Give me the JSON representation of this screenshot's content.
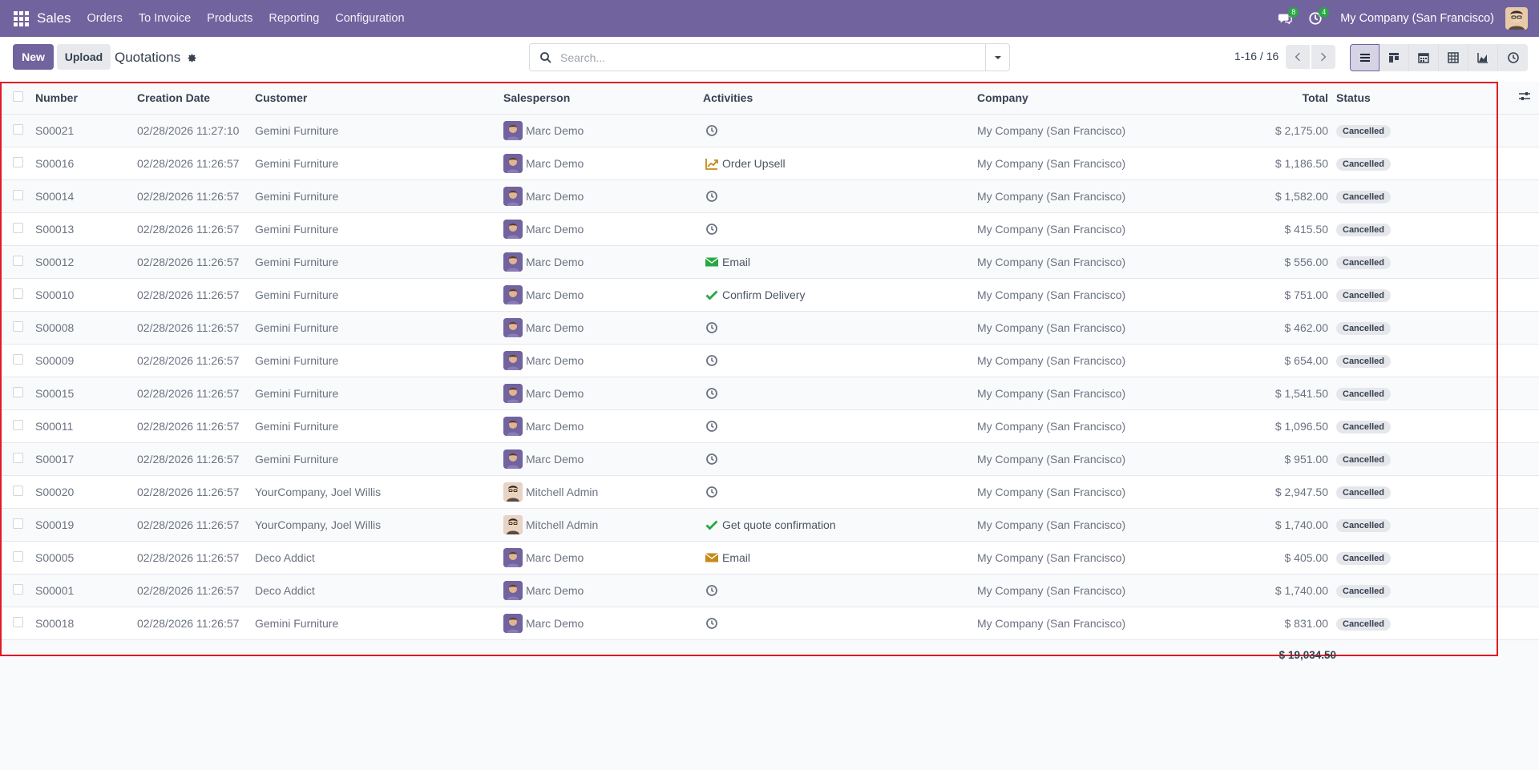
{
  "navbar": {
    "app_name": "Sales",
    "menu": [
      "Orders",
      "To Invoice",
      "Products",
      "Reporting",
      "Configuration"
    ],
    "messages_count": "8",
    "activities_count": "4",
    "company": "My Company (San Francisco)"
  },
  "control": {
    "new_label": "New",
    "upload_label": "Upload",
    "breadcrumb": "Quotations",
    "search_placeholder": "Search...",
    "pager": "1-16 / 16"
  },
  "table": {
    "headers": {
      "number": "Number",
      "creation_date": "Creation Date",
      "customer": "Customer",
      "salesperson": "Salesperson",
      "activities": "Activities",
      "company": "Company",
      "total": "Total",
      "status": "Status"
    },
    "rows": [
      {
        "number": "S00021",
        "date": "02/28/2026 11:27:10",
        "customer": "Gemini Furniture",
        "salesperson": "Marc Demo",
        "sp_type": "marc",
        "activity_icon": "clock-icon",
        "activity": "",
        "company": "My Company (San Francisco)",
        "total": "$ 2,175.00",
        "status": "Cancelled"
      },
      {
        "number": "S00016",
        "date": "02/28/2026 11:26:57",
        "customer": "Gemini Furniture",
        "salesperson": "Marc Demo",
        "sp_type": "marc",
        "activity_icon": "chart-up-icon",
        "activity": "Order Upsell",
        "company": "My Company (San Francisco)",
        "total": "$ 1,186.50",
        "status": "Cancelled"
      },
      {
        "number": "S00014",
        "date": "02/28/2026 11:26:57",
        "customer": "Gemini Furniture",
        "salesperson": "Marc Demo",
        "sp_type": "marc",
        "activity_icon": "clock-icon",
        "activity": "",
        "company": "My Company (San Francisco)",
        "total": "$ 1,582.00",
        "status": "Cancelled"
      },
      {
        "number": "S00013",
        "date": "02/28/2026 11:26:57",
        "customer": "Gemini Furniture",
        "salesperson": "Marc Demo",
        "sp_type": "marc",
        "activity_icon": "clock-icon",
        "activity": "",
        "company": "My Company (San Francisco)",
        "total": "$ 415.50",
        "status": "Cancelled"
      },
      {
        "number": "S00012",
        "date": "02/28/2026 11:26:57",
        "customer": "Gemini Furniture",
        "salesperson": "Marc Demo",
        "sp_type": "marc",
        "activity_icon": "email-green-icon",
        "activity": "Email",
        "company": "My Company (San Francisco)",
        "total": "$ 556.00",
        "status": "Cancelled"
      },
      {
        "number": "S00010",
        "date": "02/28/2026 11:26:57",
        "customer": "Gemini Furniture",
        "salesperson": "Marc Demo",
        "sp_type": "marc",
        "activity_icon": "check-icon",
        "activity": "Confirm Delivery",
        "company": "My Company (San Francisco)",
        "total": "$ 751.00",
        "status": "Cancelled"
      },
      {
        "number": "S00008",
        "date": "02/28/2026 11:26:57",
        "customer": "Gemini Furniture",
        "salesperson": "Marc Demo",
        "sp_type": "marc",
        "activity_icon": "clock-icon",
        "activity": "",
        "company": "My Company (San Francisco)",
        "total": "$ 462.00",
        "status": "Cancelled"
      },
      {
        "number": "S00009",
        "date": "02/28/2026 11:26:57",
        "customer": "Gemini Furniture",
        "salesperson": "Marc Demo",
        "sp_type": "marc",
        "activity_icon": "clock-icon",
        "activity": "",
        "company": "My Company (San Francisco)",
        "total": "$ 654.00",
        "status": "Cancelled"
      },
      {
        "number": "S00015",
        "date": "02/28/2026 11:26:57",
        "customer": "Gemini Furniture",
        "salesperson": "Marc Demo",
        "sp_type": "marc",
        "activity_icon": "clock-icon",
        "activity": "",
        "company": "My Company (San Francisco)",
        "total": "$ 1,541.50",
        "status": "Cancelled"
      },
      {
        "number": "S00011",
        "date": "02/28/2026 11:26:57",
        "customer": "Gemini Furniture",
        "salesperson": "Marc Demo",
        "sp_type": "marc",
        "activity_icon": "clock-icon",
        "activity": "",
        "company": "My Company (San Francisco)",
        "total": "$ 1,096.50",
        "status": "Cancelled"
      },
      {
        "number": "S00017",
        "date": "02/28/2026 11:26:57",
        "customer": "Gemini Furniture",
        "salesperson": "Marc Demo",
        "sp_type": "marc",
        "activity_icon": "clock-icon",
        "activity": "",
        "company": "My Company (San Francisco)",
        "total": "$ 951.00",
        "status": "Cancelled"
      },
      {
        "number": "S00020",
        "date": "02/28/2026 11:26:57",
        "customer": "YourCompany, Joel Willis",
        "salesperson": "Mitchell Admin",
        "sp_type": "admin",
        "activity_icon": "clock-icon",
        "activity": "",
        "company": "My Company (San Francisco)",
        "total": "$ 2,947.50",
        "status": "Cancelled"
      },
      {
        "number": "S00019",
        "date": "02/28/2026 11:26:57",
        "customer": "YourCompany, Joel Willis",
        "salesperson": "Mitchell Admin",
        "sp_type": "admin",
        "activity_icon": "check-icon",
        "activity": "Get quote confirmation",
        "company": "My Company (San Francisco)",
        "total": "$ 1,740.00",
        "status": "Cancelled"
      },
      {
        "number": "S00005",
        "date": "02/28/2026 11:26:57",
        "customer": "Deco Addict",
        "salesperson": "Marc Demo",
        "sp_type": "marc",
        "activity_icon": "email-orange-icon",
        "activity": "Email",
        "company": "My Company (San Francisco)",
        "total": "$ 405.00",
        "status": "Cancelled"
      },
      {
        "number": "S00001",
        "date": "02/28/2026 11:26:57",
        "customer": "Deco Addict",
        "salesperson": "Marc Demo",
        "sp_type": "marc",
        "activity_icon": "clock-icon",
        "activity": "",
        "company": "My Company (San Francisco)",
        "total": "$ 1,740.00",
        "status": "Cancelled"
      },
      {
        "number": "S00018",
        "date": "02/28/2026 11:26:57",
        "customer": "Gemini Furniture",
        "salesperson": "Marc Demo",
        "sp_type": "marc",
        "activity_icon": "clock-icon",
        "activity": "",
        "company": "My Company (San Francisco)",
        "total": "$ 831.00",
        "status": "Cancelled"
      }
    ],
    "grand_total": "$ 19,034.50"
  },
  "colors": {
    "brand": "#71639e",
    "badge_green": "#28a745",
    "selection_outline": "#e01b24",
    "activity_green": "#28a745",
    "activity_orange": "#c68a1a"
  }
}
